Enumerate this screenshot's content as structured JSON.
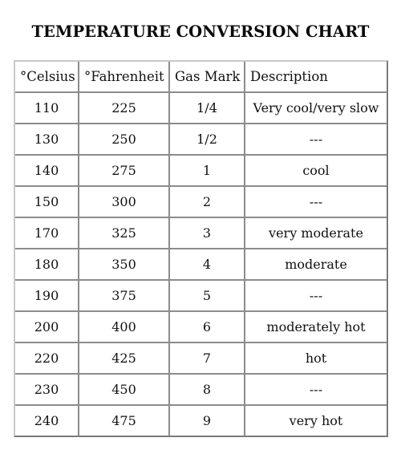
{
  "title": "TEMPERATURE CONVERSION CHART",
  "table": {
    "headers": [
      "°Celsius",
      "°Fahrenheit",
      "Gas Mark",
      "Description"
    ],
    "rows": [
      {
        "celsius": "110",
        "fahrenheit": "225",
        "gas_mark": "1/4",
        "description": "Very cool/very slow"
      },
      {
        "celsius": "130",
        "fahrenheit": "250",
        "gas_mark": "1/2",
        "description": "---"
      },
      {
        "celsius": "140",
        "fahrenheit": "275",
        "gas_mark": "1",
        "description": "cool"
      },
      {
        "celsius": "150",
        "fahrenheit": "300",
        "gas_mark": "2",
        "description": "---"
      },
      {
        "celsius": "170",
        "fahrenheit": "325",
        "gas_mark": "3",
        "description": "very moderate"
      },
      {
        "celsius": "180",
        "fahrenheit": "350",
        "gas_mark": "4",
        "description": "moderate"
      },
      {
        "celsius": "190",
        "fahrenheit": "375",
        "gas_mark": "5",
        "description": "---"
      },
      {
        "celsius": "200",
        "fahrenheit": "400",
        "gas_mark": "6",
        "description": "moderately hot"
      },
      {
        "celsius": "220",
        "fahrenheit": "425",
        "gas_mark": "7",
        "description": "hot"
      },
      {
        "celsius": "230",
        "fahrenheit": "450",
        "gas_mark": "8",
        "description": "---"
      },
      {
        "celsius": "240",
        "fahrenheit": "475",
        "gas_mark": "9",
        "description": "very hot"
      }
    ]
  }
}
